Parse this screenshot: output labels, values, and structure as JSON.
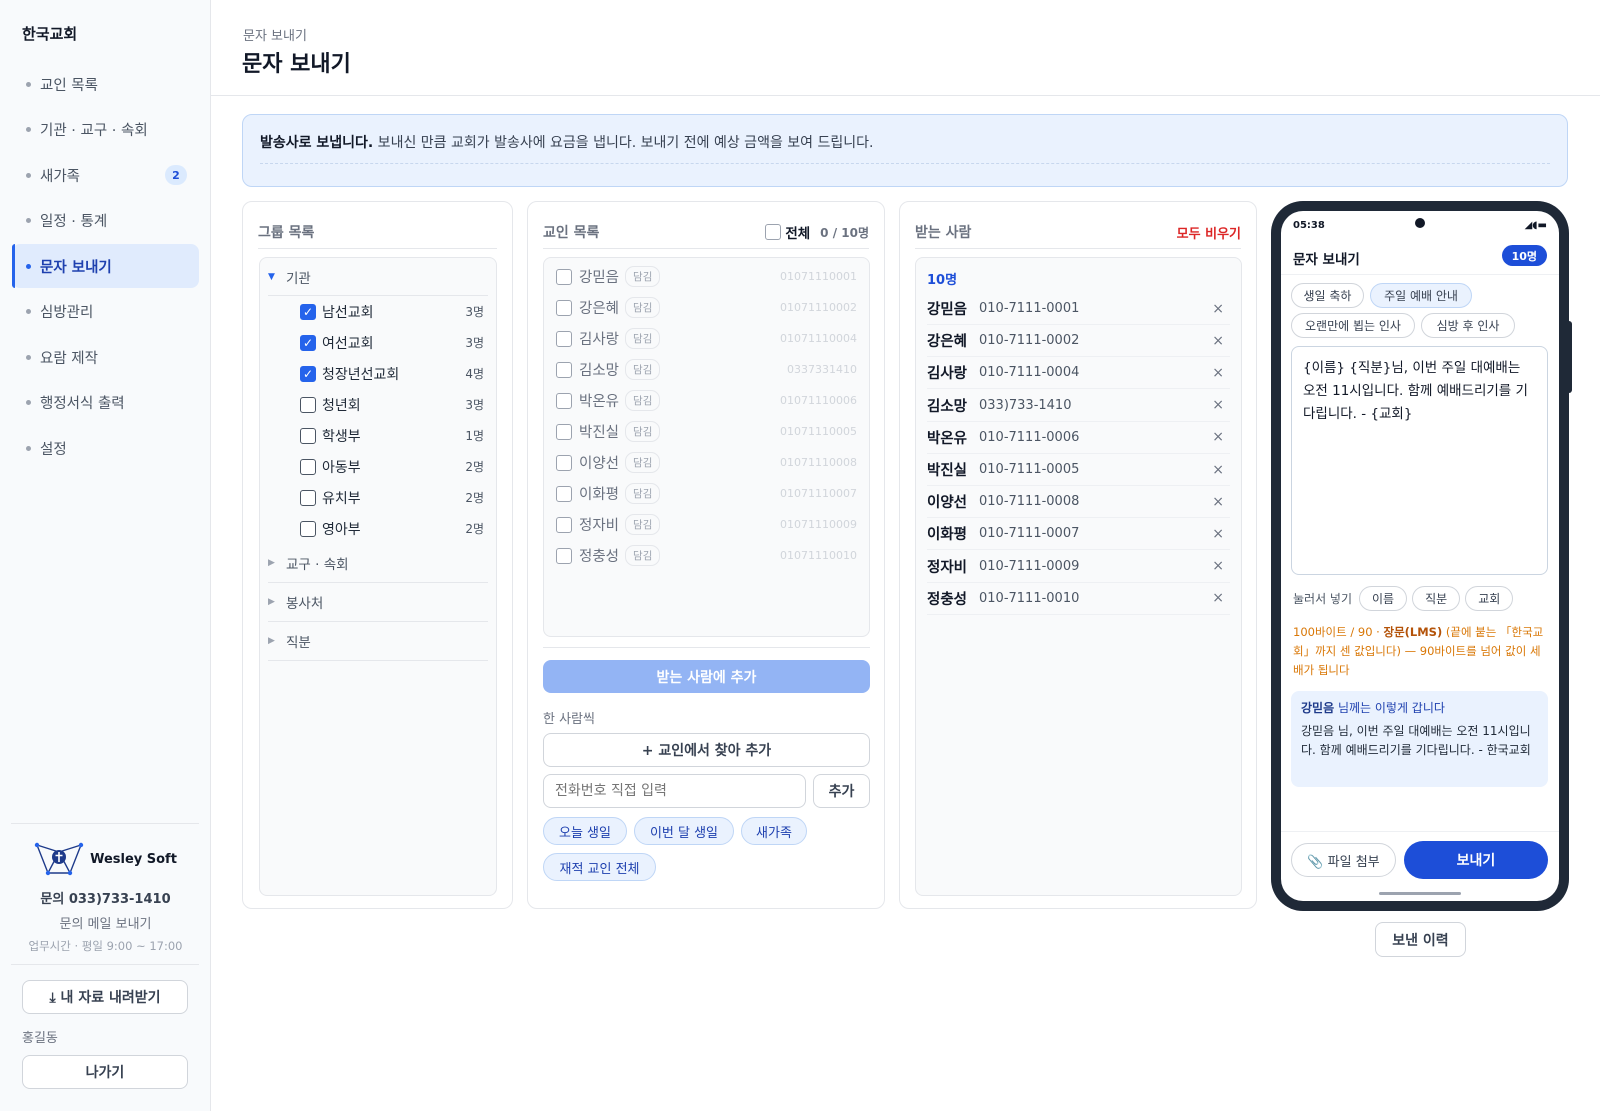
{
  "sidebar": {
    "brand": "한국교회",
    "items": [
      {
        "label": "교인 목록",
        "badge": ""
      },
      {
        "label": "기관 · 교구 · 속회",
        "badge": ""
      },
      {
        "label": "새가족",
        "badge": "2"
      },
      {
        "label": "일정 · 통계",
        "badge": ""
      },
      {
        "label": "문자 보내기",
        "badge": "",
        "active": true
      },
      {
        "label": "심방관리",
        "badge": ""
      },
      {
        "label": "요람 제작",
        "badge": ""
      },
      {
        "label": "행정서식 출력",
        "badge": ""
      },
      {
        "label": "설정",
        "badge": ""
      }
    ],
    "company": {
      "logo_name": "Wesley Soft",
      "phone": "문의 033)733-1410",
      "mail": "문의 메일 보내기",
      "hours": "업무시간 · 평일 9:00 ~ 17:00"
    },
    "download_label": "⤓ 내 자료 내려받기",
    "user_name": "홍길동",
    "logout_label": "나가기"
  },
  "header": {
    "breadcrumb": "문자 보내기",
    "title": "문자 보내기"
  },
  "notice": {
    "bold": "발송사로 보냅니다.",
    "text": " 보내신 만큼 교회가 발송사에 요금을 냅니다. 보내기 전에 예상 금액을 보여 드립니다."
  },
  "groups": {
    "title": "그룹 목록",
    "open_category": "기관",
    "items": [
      {
        "name": "남선교회",
        "count": "3명",
        "checked": true
      },
      {
        "name": "여선교회",
        "count": "3명",
        "checked": true
      },
      {
        "name": "청장년선교회",
        "count": "4명",
        "checked": true
      },
      {
        "name": "청년회",
        "count": "3명",
        "checked": false
      },
      {
        "name": "학생부",
        "count": "1명",
        "checked": false
      },
      {
        "name": "아동부",
        "count": "2명",
        "checked": false
      },
      {
        "name": "유치부",
        "count": "2명",
        "checked": false
      },
      {
        "name": "영아부",
        "count": "2명",
        "checked": false
      }
    ],
    "closed_categories": [
      "교구 · 속회",
      "봉사처",
      "직분"
    ]
  },
  "members": {
    "title": "교인 목록",
    "select_all_label": "전체",
    "count": "0 / 10명",
    "tag": "담김",
    "items": [
      {
        "name": "강믿음",
        "phone": "01071110001"
      },
      {
        "name": "강은혜",
        "phone": "01071110002"
      },
      {
        "name": "김사랑",
        "phone": "01071110004"
      },
      {
        "name": "김소망",
        "phone": "0337331410"
      },
      {
        "name": "박온유",
        "phone": "01071110006"
      },
      {
        "name": "박진실",
        "phone": "01071110005"
      },
      {
        "name": "이양선",
        "phone": "01071110008"
      },
      {
        "name": "이화평",
        "phone": "01071110007"
      },
      {
        "name": "정자비",
        "phone": "01071110009"
      },
      {
        "name": "정충성",
        "phone": "01071110010"
      }
    ],
    "add_button": "받는 사람에 추가",
    "single_label": "한 사람씩",
    "find_button": "+ 교인에서 찾아 추가",
    "phone_placeholder": "전화번호 직접 입력",
    "add_small": "추가",
    "quick_chips": [
      "오늘 생일",
      "이번 달 생일",
      "새가족",
      "재적 교인 전체"
    ]
  },
  "recipients": {
    "title": "받는 사람",
    "clear_label": "모두 비우기",
    "count": "10명",
    "items": [
      {
        "name": "강믿음",
        "phone": "010-7111-0001"
      },
      {
        "name": "강은혜",
        "phone": "010-7111-0002"
      },
      {
        "name": "김사랑",
        "phone": "010-7111-0004"
      },
      {
        "name": "김소망",
        "phone": "033)733-1410"
      },
      {
        "name": "박온유",
        "phone": "010-7111-0006"
      },
      {
        "name": "박진실",
        "phone": "010-7111-0005"
      },
      {
        "name": "이양선",
        "phone": "010-7111-0008"
      },
      {
        "name": "이화평",
        "phone": "010-7111-0007"
      },
      {
        "name": "정자비",
        "phone": "010-7111-0009"
      },
      {
        "name": "정충성",
        "phone": "010-7111-0010"
      }
    ],
    "remove_glyph": "×"
  },
  "phone": {
    "time": "05:38",
    "status_icons": "◢◖▬",
    "app_title": "문자 보내기",
    "badge": "10명",
    "templates": [
      "생일 축하",
      "주일 예배 안내",
      "오랜만에 뵙는 인사",
      "심방 후 인사"
    ],
    "selected_template": "주일 예배 안내",
    "message": "{이름} {직분}님, 이번 주일 대예배는 오전 11시입니다. 함께 예배드리기를 기다립니다. - {교회}",
    "insert_label": "눌러서 넣기",
    "insert_chips": [
      "이름",
      "직분",
      "교회"
    ],
    "byte_prefix": "100바이트 / 90 · ",
    "byte_bold": "장문(LMS)",
    "byte_suffix": " (끝에 붙는 「한국교회」까지 센 값입니다) — 90바이트를 넘어 값이 세 배가 됩니다",
    "preview_name": "강믿음",
    "preview_suffix": " 님께는 이렇게 갑니다",
    "preview_body": "강믿음 님, 이번 주일 대예배는 오전 11시입니다. 함께 예배드리기를 기다립니다. - 한국교회",
    "attach_label": "📎 파일 첨부",
    "send_label": "보내기"
  },
  "history_label": "보낸 이력",
  "colors": {
    "accent": "#2563eb",
    "accent_dark": "#1d4ed8",
    "danger": "#dc2626",
    "warning": "#d97706"
  }
}
